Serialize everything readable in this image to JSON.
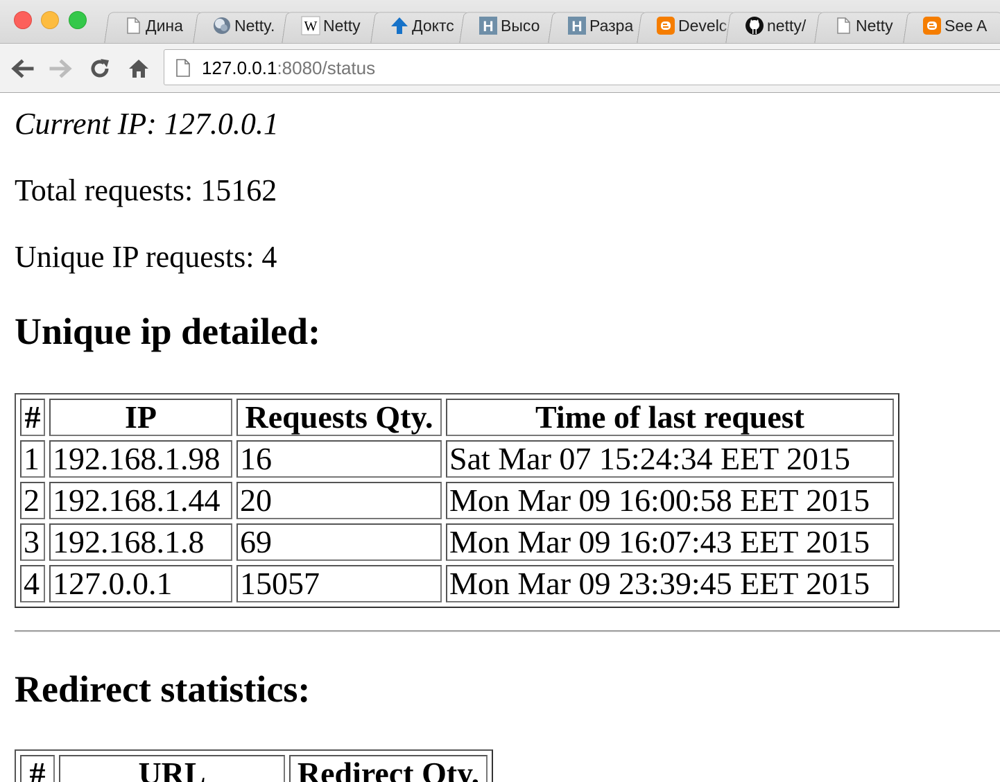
{
  "browser": {
    "tabs": [
      {
        "label": "Дина",
        "icon": "page-icon"
      },
      {
        "label": "Netty.",
        "icon": "globe-icon"
      },
      {
        "label": "Netty",
        "icon": "wikipedia-icon"
      },
      {
        "label": "Доктс",
        "icon": "up-arrow-icon"
      },
      {
        "label": "Высо",
        "icon": "habr-icon"
      },
      {
        "label": "Разра",
        "icon": "habr-icon"
      },
      {
        "label": "Develc",
        "icon": "blogger-icon"
      },
      {
        "label": "netty/",
        "icon": "github-icon"
      },
      {
        "label": "Netty",
        "icon": "page-icon"
      },
      {
        "label": "See A",
        "icon": "blogger-icon"
      }
    ],
    "url_host": "127.0.0.1",
    "url_rest": ":8080/status"
  },
  "status": {
    "current_ip": "Current IP: 127.0.0.1",
    "total_requests": "Total requests: 15162",
    "unique_ip_requests": "Unique IP requests: 4"
  },
  "unique_ip": {
    "heading": "Unique ip detailed:",
    "columns": [
      "#",
      "IP",
      "Requests Qty.",
      "Time of last request"
    ],
    "rows": [
      [
        "1",
        "192.168.1.98",
        "16",
        "Sat Mar 07 15:24:34 EET 2015"
      ],
      [
        "2",
        "192.168.1.44",
        "20",
        "Mon Mar 09 16:00:58 EET 2015"
      ],
      [
        "3",
        "192.168.1.8",
        "69",
        "Mon Mar 09 16:07:43 EET 2015"
      ],
      [
        "4",
        "127.0.0.1",
        "15057",
        "Mon Mar 09 23:39:45 EET 2015"
      ]
    ]
  },
  "redirects": {
    "heading": "Redirect statistics:",
    "columns": [
      "#",
      "URL",
      "Redirect Qty."
    ]
  },
  "colors": {
    "close": "#fc605b",
    "minimize": "#fdbc40",
    "zoom": "#34c84a",
    "habr": "#6f8fa8",
    "blogger": "#f57d00",
    "nav_arrow": "#1672c8"
  }
}
